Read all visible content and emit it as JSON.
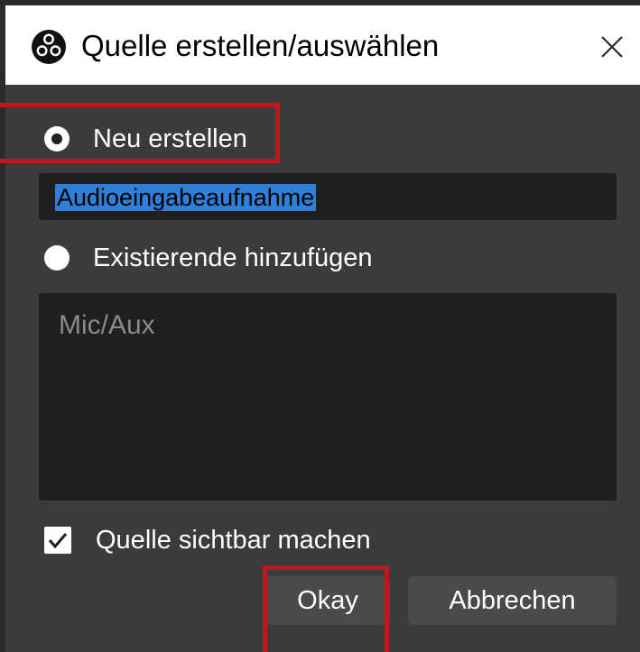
{
  "window": {
    "title": "Quelle erstellen/auswählen",
    "icon": "obs-logo-icon",
    "close_icon": "close-icon"
  },
  "create_new": {
    "label": "Neu erstellen",
    "selected": true,
    "name_value": "Audioeingabeaufnahme"
  },
  "add_existing": {
    "label": "Existierende hinzufügen",
    "selected": false,
    "items": [
      "Mic/Aux"
    ]
  },
  "visible_checkbox": {
    "label": "Quelle sichtbar machen",
    "checked": true
  },
  "buttons": {
    "okay": "Okay",
    "cancel": "Abbrechen"
  },
  "colors": {
    "highlight": "#c0161d",
    "selection": "#2f7fd8",
    "background": "#3b3b3b"
  }
}
